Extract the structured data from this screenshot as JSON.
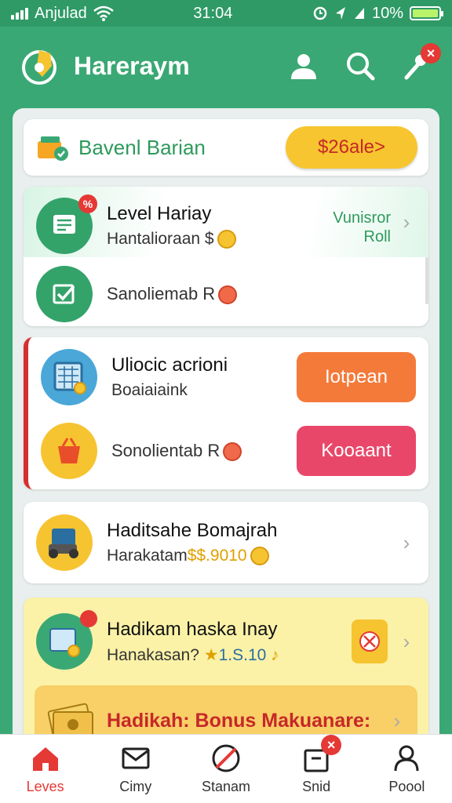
{
  "status_bar": {
    "carrier": "Anjulad",
    "time": "31:04",
    "battery": "10%"
  },
  "header": {
    "title": "Hareraym",
    "notification_badge": "×"
  },
  "promo": {
    "text": "Bavenl Barian",
    "button_label": "$26ale>"
  },
  "level": {
    "title": "Level Hariay",
    "subtitle": "Hantalioraan $",
    "side_link": "Vunisror\nRoll",
    "badge": "%",
    "second_row": "Sanoliemab R"
  },
  "unlock": {
    "title": "Uliocic acrioni",
    "subtitle": "Boaiaiaink",
    "button_top": "Iotpean",
    "second_row": "Sonolientab R",
    "button_bottom": "Kooaant",
    "button_top_color": "#f47a3a",
    "button_bottom_color": "#e9476a"
  },
  "hard": {
    "title": "Haditsahe Bomajrah",
    "sub_prefix": "Harakatam",
    "sub_value": "$$.9010"
  },
  "yellow": {
    "title": "Hadikam haska Inay",
    "sub_prefix": "Hanakasan?",
    "sub_star": "★",
    "sub_value": "1.S.10",
    "sub_suffix": "♪",
    "bonus_title": "Hadikah: Bonus Makuanare:"
  },
  "nav": [
    {
      "label": "Leves",
      "icon": "home-icon",
      "active": true
    },
    {
      "label": "Cimy",
      "icon": "mail-icon",
      "active": false
    },
    {
      "label": "Stanam",
      "icon": "no-ads-icon",
      "active": false
    },
    {
      "label": "Snid",
      "icon": "bag-icon",
      "active": false,
      "badge": "×"
    },
    {
      "label": "Poool",
      "icon": "profile-icon",
      "active": false
    }
  ],
  "colors": {
    "brand_green": "#3aa874",
    "accent_yellow": "#f6c430",
    "alert_red": "#e53935"
  }
}
